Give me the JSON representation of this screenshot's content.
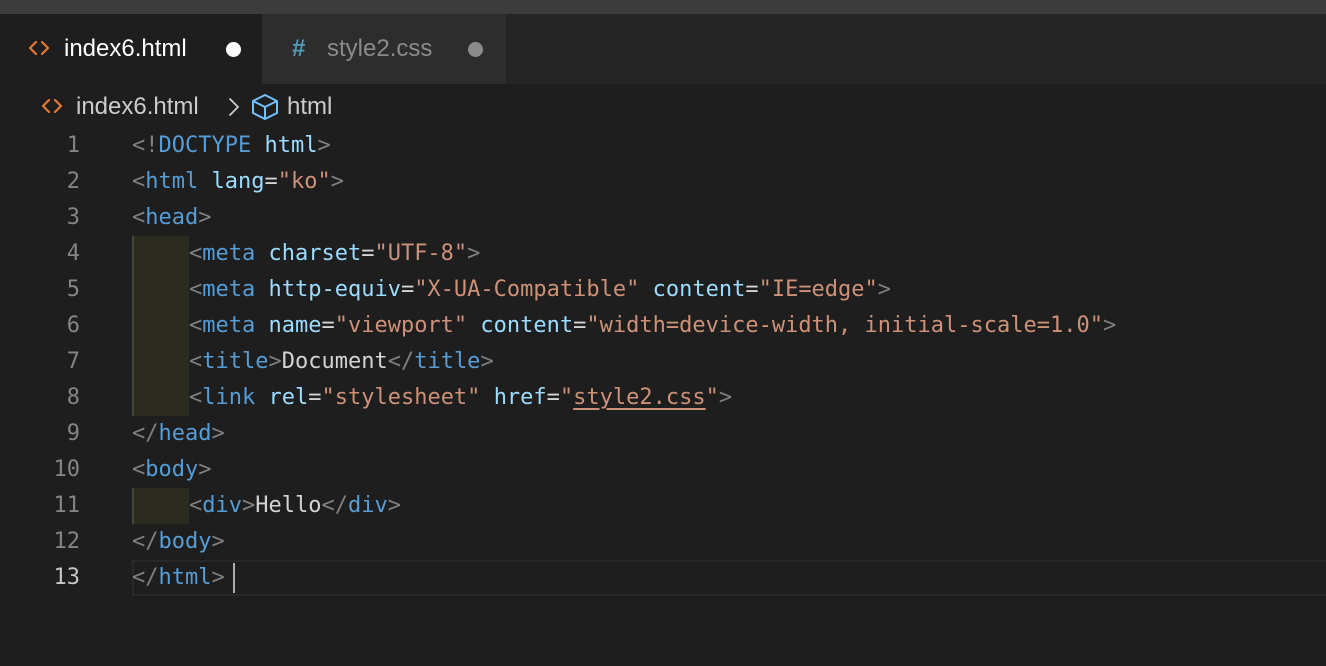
{
  "tabs": [
    {
      "label": "index6.html",
      "icon": "html-file-icon",
      "modified": true,
      "active": true
    },
    {
      "label": "style2.css",
      "icon": "css-file-icon",
      "icon_glyph": "#",
      "modified": true,
      "active": false
    }
  ],
  "breadcrumb": {
    "file": "index6.html",
    "symbol": "html"
  },
  "current_line": 13,
  "lines": [
    {
      "number": "1",
      "tokens": [
        {
          "t": "p",
          "v": "<!"
        },
        {
          "t": "tag",
          "v": "DOCTYPE"
        },
        {
          "t": "txt",
          "v": " "
        },
        {
          "t": "attr",
          "v": "html"
        },
        {
          "t": "p",
          "v": ">"
        }
      ]
    },
    {
      "number": "2",
      "tokens": [
        {
          "t": "p",
          "v": "<"
        },
        {
          "t": "tag",
          "v": "html"
        },
        {
          "t": "txt",
          "v": " "
        },
        {
          "t": "attr",
          "v": "lang"
        },
        {
          "t": "txt",
          "v": "="
        },
        {
          "t": "str",
          "v": "\"ko\""
        },
        {
          "t": "p",
          "v": ">"
        }
      ]
    },
    {
      "number": "3",
      "tokens": [
        {
          "t": "p",
          "v": "<"
        },
        {
          "t": "tag",
          "v": "head"
        },
        {
          "t": "p",
          "v": ">"
        }
      ]
    },
    {
      "number": "4",
      "indent": 1,
      "tokens": [
        {
          "t": "p",
          "v": "<"
        },
        {
          "t": "tag",
          "v": "meta"
        },
        {
          "t": "txt",
          "v": " "
        },
        {
          "t": "attr",
          "v": "charset"
        },
        {
          "t": "txt",
          "v": "="
        },
        {
          "t": "str",
          "v": "\"UTF-8\""
        },
        {
          "t": "p",
          "v": ">"
        }
      ]
    },
    {
      "number": "5",
      "indent": 1,
      "tokens": [
        {
          "t": "p",
          "v": "<"
        },
        {
          "t": "tag",
          "v": "meta"
        },
        {
          "t": "txt",
          "v": " "
        },
        {
          "t": "attr",
          "v": "http-equiv"
        },
        {
          "t": "txt",
          "v": "="
        },
        {
          "t": "str",
          "v": "\"X-UA-Compatible\""
        },
        {
          "t": "txt",
          "v": " "
        },
        {
          "t": "attr",
          "v": "content"
        },
        {
          "t": "txt",
          "v": "="
        },
        {
          "t": "str",
          "v": "\"IE=edge\""
        },
        {
          "t": "p",
          "v": ">"
        }
      ]
    },
    {
      "number": "6",
      "indent": 1,
      "tokens": [
        {
          "t": "p",
          "v": "<"
        },
        {
          "t": "tag",
          "v": "meta"
        },
        {
          "t": "txt",
          "v": " "
        },
        {
          "t": "attr",
          "v": "name"
        },
        {
          "t": "txt",
          "v": "="
        },
        {
          "t": "str",
          "v": "\"viewport\""
        },
        {
          "t": "txt",
          "v": " "
        },
        {
          "t": "attr",
          "v": "content"
        },
        {
          "t": "txt",
          "v": "="
        },
        {
          "t": "str",
          "v": "\"width=device-width, initial-scale=1.0\""
        },
        {
          "t": "p",
          "v": ">"
        }
      ]
    },
    {
      "number": "7",
      "indent": 1,
      "tokens": [
        {
          "t": "p",
          "v": "<"
        },
        {
          "t": "tag",
          "v": "title"
        },
        {
          "t": "p",
          "v": ">"
        },
        {
          "t": "txt",
          "v": "Document"
        },
        {
          "t": "p",
          "v": "</"
        },
        {
          "t": "tag",
          "v": "title"
        },
        {
          "t": "p",
          "v": ">"
        }
      ]
    },
    {
      "number": "8",
      "indent": 1,
      "tokens": [
        {
          "t": "p",
          "v": "<"
        },
        {
          "t": "tag",
          "v": "link"
        },
        {
          "t": "txt",
          "v": " "
        },
        {
          "t": "attr",
          "v": "rel"
        },
        {
          "t": "txt",
          "v": "="
        },
        {
          "t": "str",
          "v": "\"stylesheet\""
        },
        {
          "t": "txt",
          "v": " "
        },
        {
          "t": "attr",
          "v": "href"
        },
        {
          "t": "txt",
          "v": "="
        },
        {
          "t": "str",
          "v": "\""
        },
        {
          "t": "link",
          "v": "style2.css"
        },
        {
          "t": "str",
          "v": "\""
        },
        {
          "t": "p",
          "v": ">"
        }
      ]
    },
    {
      "number": "9",
      "tokens": [
        {
          "t": "p",
          "v": "</"
        },
        {
          "t": "tag",
          "v": "head"
        },
        {
          "t": "p",
          "v": ">"
        }
      ]
    },
    {
      "number": "10",
      "tokens": [
        {
          "t": "p",
          "v": "<"
        },
        {
          "t": "tag",
          "v": "body"
        },
        {
          "t": "p",
          "v": ">"
        }
      ]
    },
    {
      "number": "11",
      "indent": 1,
      "tokens": [
        {
          "t": "p",
          "v": "<"
        },
        {
          "t": "tag",
          "v": "div"
        },
        {
          "t": "p",
          "v": ">"
        },
        {
          "t": "txt",
          "v": "Hello"
        },
        {
          "t": "p",
          "v": "</"
        },
        {
          "t": "tag",
          "v": "div"
        },
        {
          "t": "p",
          "v": ">"
        }
      ]
    },
    {
      "number": "12",
      "tokens": [
        {
          "t": "p",
          "v": "</"
        },
        {
          "t": "tag",
          "v": "body"
        },
        {
          "t": "p",
          "v": ">"
        }
      ]
    },
    {
      "number": "13",
      "tokens": [
        {
          "t": "p",
          "v": "</"
        },
        {
          "t": "tag",
          "v": "html"
        },
        {
          "t": "p",
          "v": ">"
        }
      ]
    }
  ],
  "colors": {
    "editor_bg": "#1e1e1e",
    "tag": "#569cd6",
    "attribute": "#9cdcfe",
    "string": "#ce9178",
    "punctuation": "#808080",
    "text": "#d4d4d4",
    "line_number": "#858585"
  }
}
